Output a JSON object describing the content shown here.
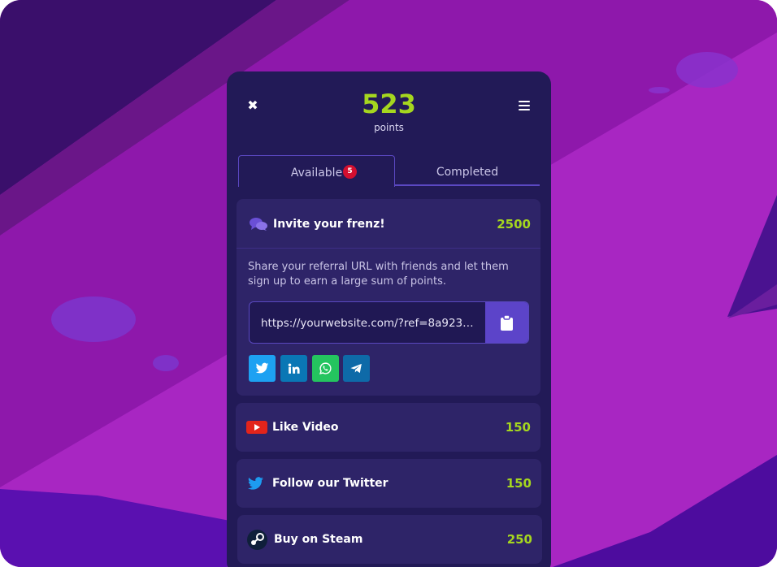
{
  "header": {
    "points_value": "523",
    "points_label": "points",
    "close_glyph": "✖"
  },
  "tabs": {
    "available_label": "Available",
    "available_count": "5",
    "completed_label": "Completed"
  },
  "invite": {
    "title": "Invite your frenz!",
    "points": "2500",
    "description": "Share your referral URL with friends and let them sign up to earn a large sum of points.",
    "referral_url": "https://yourwebsite.com/?ref=8a9230...",
    "share_buttons": [
      {
        "icon": "twitter-icon",
        "color": "#1da1f2"
      },
      {
        "icon": "linkedin-icon",
        "color": "#0a77b5"
      },
      {
        "icon": "whatsapp-icon",
        "color": "#24c45f"
      },
      {
        "icon": "telegram-icon",
        "color": "#0e6aa8"
      }
    ]
  },
  "tasks": [
    {
      "title": "Like Video",
      "points": "150",
      "icon": "youtube-icon"
    },
    {
      "title": "Follow our Twitter",
      "points": "150",
      "icon": "twitter-icon"
    },
    {
      "title": "Buy on Steam",
      "points": "250",
      "icon": "steam-icon"
    }
  ],
  "colors": {
    "accent_green": "#a5d61f",
    "panel_bg": "#221a57",
    "card_bg": "#2e2468",
    "primary_purple": "#5c44c9"
  }
}
